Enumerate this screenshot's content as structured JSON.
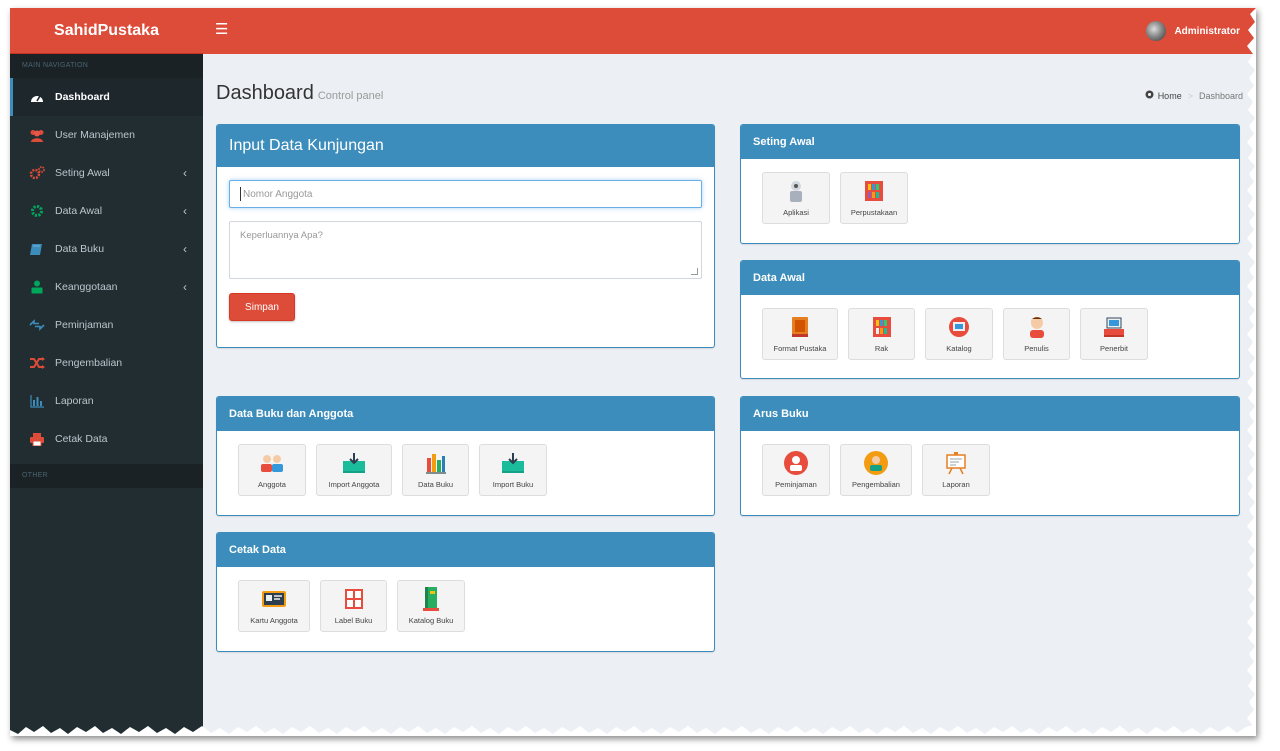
{
  "app": {
    "name": "SahidPustaka"
  },
  "header": {
    "user_name": "Administrator"
  },
  "sidebar": {
    "main_header": "MAIN NAVIGATION",
    "other_header": "OTHER",
    "items": [
      {
        "label": "Dashboard",
        "icon": "dashboard-icon",
        "active": true
      },
      {
        "label": "User Manajemen",
        "icon": "users-icon"
      },
      {
        "label": "Seting Awal",
        "icon": "gears-icon",
        "expandable": true
      },
      {
        "label": "Data Awal",
        "icon": "gear-icon",
        "expandable": true
      },
      {
        "label": "Data Buku",
        "icon": "book-icon",
        "expandable": true
      },
      {
        "label": "Keanggotaan",
        "icon": "user-icon",
        "expandable": true
      },
      {
        "label": "Peminjaman",
        "icon": "exchange-icon"
      },
      {
        "label": "Pengembalian",
        "icon": "shuffle-icon"
      },
      {
        "label": "Laporan",
        "icon": "bar-chart-icon"
      },
      {
        "label": "Cetak Data",
        "icon": "print-icon"
      }
    ]
  },
  "page": {
    "title": "Dashboard",
    "subtitle": "Control panel",
    "breadcrumb": {
      "home": "Home",
      "current": "Dashboard"
    }
  },
  "visit_form": {
    "title": "Input Data Kunjungan",
    "member_placeholder": "Nomor Anggota",
    "purpose_placeholder": "Keperluannya Apa?",
    "submit_label": "Simpan"
  },
  "seting_awal": {
    "title": "Seting Awal",
    "tiles": [
      "Aplikasi",
      "Perpustakaan"
    ]
  },
  "data_awal": {
    "title": "Data Awal",
    "tiles": [
      "Format Pustaka",
      "Rak",
      "Katalog",
      "Penulis",
      "Penerbit"
    ]
  },
  "data_buku_anggota": {
    "title": "Data Buku dan Anggota",
    "tiles": [
      "Anggota",
      "Import Anggota",
      "Data Buku",
      "Import Buku"
    ]
  },
  "arus_buku": {
    "title": "Arus Buku",
    "tiles": [
      "Peminjaman",
      "Pengembalian",
      "Laporan"
    ]
  },
  "cetak_data": {
    "title": "Cetak Data",
    "tiles": [
      "Kartu Anggota",
      "Label Buku",
      "Katalog Buku"
    ]
  },
  "colors": {
    "header": "#dd4b39",
    "sidebar": "#222d32",
    "box_header": "#3c8dbc",
    "content_bg": "#ecf0f5"
  }
}
